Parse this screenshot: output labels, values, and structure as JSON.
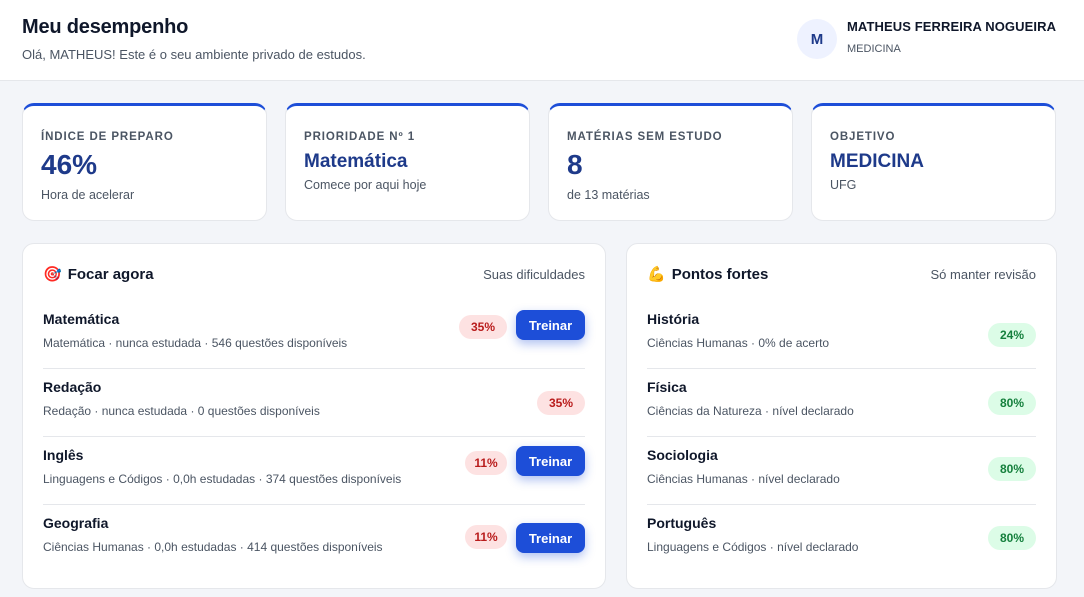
{
  "header": {
    "title": "Meu desempenho",
    "subtitle": "Olá, MATHEUS! Este é o seu ambiente privado de estudos.",
    "avatar_initial": "M",
    "user_name": "MATHEUS FERREIRA NOGUEIRA",
    "user_course": "MEDICINA"
  },
  "stats": [
    {
      "label": "ÍNDICE DE PREPARO",
      "value": "46%",
      "caption": "Hora de acelerar"
    },
    {
      "label": "PRIORIDADE Nº 1",
      "value": "Matemática",
      "caption": "Comece por aqui hoje"
    },
    {
      "label": "MATÉRIAS SEM ESTUDO",
      "value": "8",
      "caption": "de 13 matérias"
    },
    {
      "label": "OBJETIVO",
      "value": "MEDICINA",
      "caption": "UFG"
    }
  ],
  "focus": {
    "icon": "target-icon",
    "icon_glyph": "🎯",
    "title": "Focar agora",
    "note": "Suas dificuldades",
    "button_label": "Treinar",
    "items": [
      {
        "name": "Matemática",
        "meta": "Matemática · nunca estudada · 546 questões disponíveis",
        "percent": "35%",
        "has_button": true
      },
      {
        "name": "Redação",
        "meta": "Redação · nunca estudada · 0 questões disponíveis",
        "percent": "35%",
        "has_button": false
      },
      {
        "name": "Inglês",
        "meta": "Linguagens e Códigos · 0,0h estudadas · 374 questões disponíveis",
        "percent": "11%",
        "has_button": true
      },
      {
        "name": "Geografia",
        "meta": "Ciências Humanas · 0,0h estudadas · 414 questões disponíveis",
        "percent": "11%",
        "has_button": true
      }
    ]
  },
  "strengths": {
    "icon": "flexed-biceps-icon",
    "icon_glyph": "💪",
    "title": "Pontos fortes",
    "note": "Só manter revisão",
    "items": [
      {
        "name": "História",
        "meta": "Ciências Humanas · 0% de acerto",
        "percent": "24%"
      },
      {
        "name": "Física",
        "meta": "Ciências da Natureza · nível declarado",
        "percent": "80%"
      },
      {
        "name": "Sociologia",
        "meta": "Ciências Humanas · nível declarado",
        "percent": "80%"
      },
      {
        "name": "Português",
        "meta": "Linguagens e Códigos · nível declarado",
        "percent": "80%"
      }
    ]
  },
  "colors": {
    "accent": "#1d4ed8",
    "value_text": "#1e3a8a",
    "weak_badge_bg": "#fde2e2",
    "weak_badge_text": "#b91c1c",
    "strong_badge_bg": "#dcfce7",
    "strong_badge_text": "#15803d"
  }
}
